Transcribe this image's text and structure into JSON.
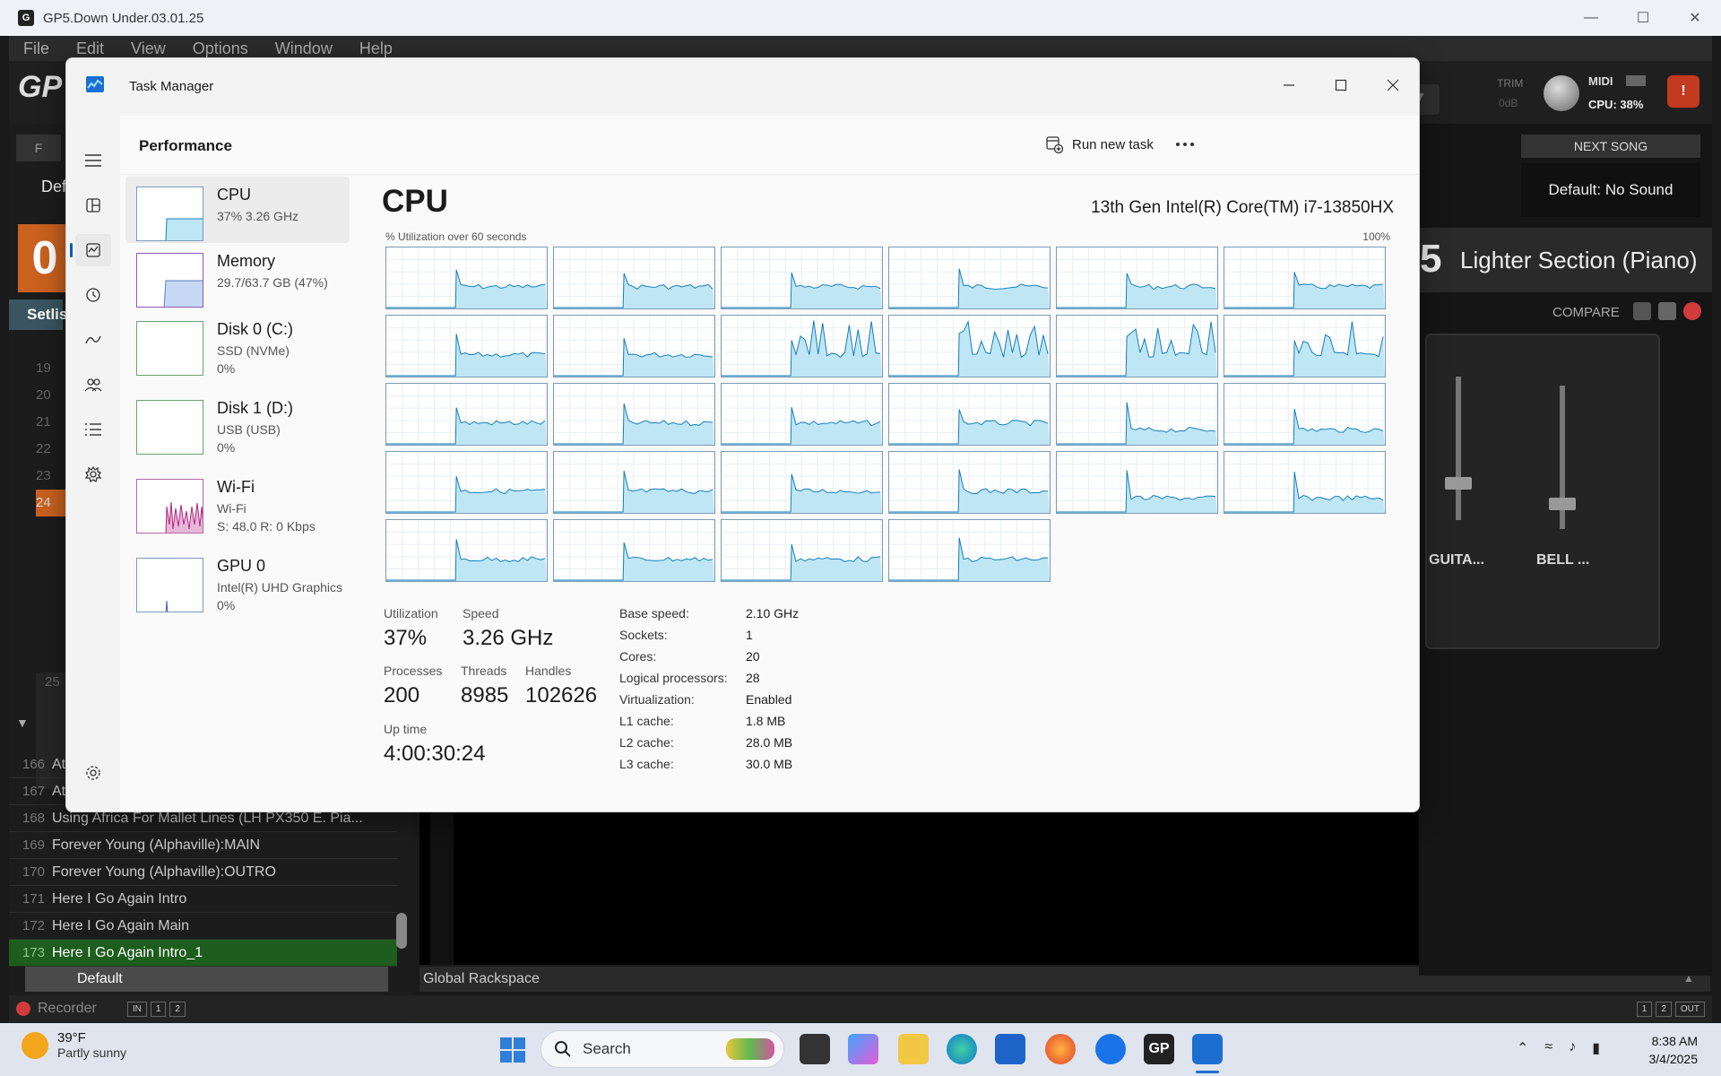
{
  "host_app": {
    "title": "GP5.Down Under.03.01.25",
    "menu": [
      "File",
      "Edit",
      "View",
      "Options",
      "Window",
      "Help"
    ],
    "trim_label": "TRIM",
    "trim_value": "0dB",
    "midi_label": "MIDI",
    "cpu_label": "CPU: 38%",
    "next_song_label": "NEXT SONG",
    "next_song_value": "Default: No Sound",
    "current_song": "Lighter Section (Piano)",
    "current_song_number": "5",
    "compare_label": "COMPARE",
    "fader_1_label": "GUITA...",
    "fader_2_label": "BELL ...",
    "setlist_tab": "Setlis",
    "partial_left": "Def",
    "big_number": "0",
    "setlist_rows": [
      {
        "num": "166",
        "name": "At"
      },
      {
        "num": "167",
        "name": "At"
      },
      {
        "num": "168",
        "name": "Using Africa For Mallet Lines (LH PX350 E. Pia..."
      },
      {
        "num": "169",
        "name": "Forever Young (Alphaville):MAIN"
      },
      {
        "num": "170",
        "name": "Forever Young (Alphaville):OUTRO"
      },
      {
        "num": "171",
        "name": "Here I Go Again Intro"
      },
      {
        "num": "172",
        "name": "Here I Go Again Main"
      },
      {
        "num": "173",
        "name": "Here I Go Again Intro_1"
      }
    ],
    "left_row_numbers": [
      "19",
      "20",
      "21",
      "22",
      "23",
      "24",
      "25"
    ],
    "default_row": "Default",
    "global_rackspace": "Global Rackspace",
    "recorder_label": "Recorder",
    "recorder_buttons": [
      "IN",
      "1",
      "2"
    ],
    "bottom_right_buttons": [
      "1",
      "2",
      "OUT"
    ]
  },
  "task_manager": {
    "title": "Task Manager",
    "page_title": "Performance",
    "run_new_task": "Run new task",
    "more_icon": "ellipsis-icon",
    "nav_icons": [
      "hamburger-icon",
      "processes-icon",
      "performance-icon",
      "app-history-icon",
      "startup-apps-icon",
      "users-icon",
      "details-icon",
      "services-icon",
      "settings-icon"
    ],
    "resources": [
      {
        "name": "CPU",
        "sub1": "37% 3.26 GHz",
        "sub2": ""
      },
      {
        "name": "Memory",
        "sub1": "29.7/63.7 GB (47%)",
        "sub2": ""
      },
      {
        "name": "Disk 0 (C:)",
        "sub1": "SSD (NVMe)",
        "sub2": "0%"
      },
      {
        "name": "Disk 1 (D:)",
        "sub1": "USB (USB)",
        "sub2": "0%"
      },
      {
        "name": "Wi-Fi",
        "sub1": "Wi-Fi",
        "sub2": "S: 48.0 R: 0 Kbps"
      },
      {
        "name": "GPU 0",
        "sub1": "Intel(R) UHD Graphics",
        "sub2": "0%"
      }
    ],
    "cpu": {
      "heading": "CPU",
      "model": "13th Gen Intel(R) Core(TM) i7-13850HX",
      "graph_label": "% Utilization over 60 seconds",
      "graph_max": "100%",
      "logical_processor_graphs": 28,
      "accent_color": "#117dbb",
      "fill_color": "#bfe6f5",
      "utilization_label": "Utilization",
      "utilization": "37%",
      "speed_label": "Speed",
      "speed": "3.26 GHz",
      "processes_label": "Processes",
      "processes": "200",
      "threads_label": "Threads",
      "threads": "8985",
      "handles_label": "Handles",
      "handles": "102626",
      "uptime_label": "Up time",
      "uptime": "4:00:30:24",
      "details": [
        {
          "k": "Base speed:",
          "v": "2.10 GHz"
        },
        {
          "k": "Sockets:",
          "v": "1"
        },
        {
          "k": "Cores:",
          "v": "20"
        },
        {
          "k": "Logical processors:",
          "v": "28"
        },
        {
          "k": "Virtualization:",
          "v": "Enabled"
        },
        {
          "k": "L1 cache:",
          "v": "1.8 MB"
        },
        {
          "k": "L2 cache:",
          "v": "28.0 MB"
        },
        {
          "k": "L3 cache:",
          "v": "30.0 MB"
        }
      ]
    }
  },
  "taskbar": {
    "temperature": "39°F",
    "weather": "Partly sunny",
    "search_placeholder": "Search",
    "time": "8:38 AM",
    "date": "3/4/2025"
  }
}
